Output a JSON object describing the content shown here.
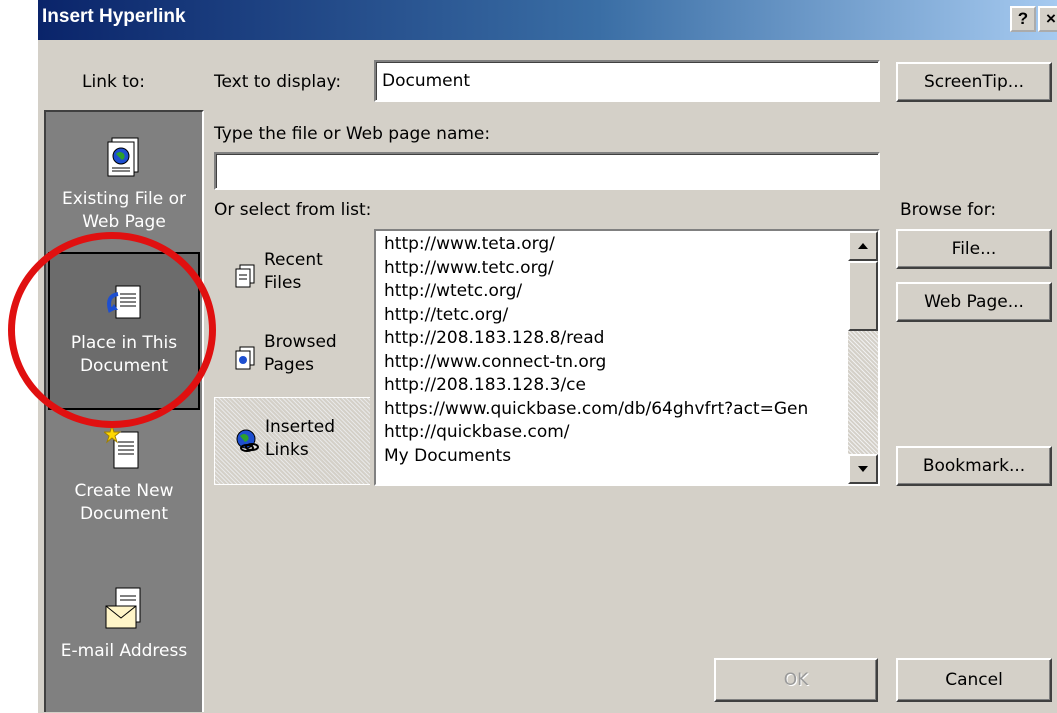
{
  "window": {
    "title": "Insert Hyperlink",
    "help_label": "?",
    "close_label": "×"
  },
  "linkto": {
    "label": "Link to:",
    "places": [
      {
        "line1": "Existing File or",
        "line2": "Web Page",
        "icon": "existing-file-icon"
      },
      {
        "line1": "Place in This",
        "line2": "Document",
        "icon": "place-in-document-icon"
      },
      {
        "line1": "Create New",
        "line2": "Document",
        "icon": "create-document-icon"
      },
      {
        "line1": "E-mail Address",
        "line2": "",
        "icon": "email-icon"
      }
    ]
  },
  "text_to_display": {
    "label": "Text to display:",
    "value": "Document"
  },
  "screentip_label": "ScreenTip...",
  "filename": {
    "label": "Type the file or Web page name:",
    "value": ""
  },
  "list_label": "Or select from list:",
  "browse_label": "Browse for:",
  "tabs": [
    {
      "line1": "Recent",
      "line2": "Files",
      "icon": "recent-files-icon"
    },
    {
      "line1": "Browsed",
      "line2": "Pages",
      "icon": "browsed-pages-icon"
    },
    {
      "line1": "Inserted",
      "line2": "Links",
      "icon": "inserted-links-icon"
    }
  ],
  "links": [
    "http://www.teta.org/",
    "http://www.tetc.org/",
    "http://wtetc.org/",
    "http://tetc.org/",
    "http://208.183.128.8/read",
    "http://www.connect-tn.org",
    "http://208.183.128.3/ce",
    "https://www.quickbase.com/db/64ghvfrt?act=Gen",
    "http://quickbase.com/",
    "My Documents"
  ],
  "buttons": {
    "file": "File...",
    "web_page": "Web Page...",
    "bookmark": "Bookmark...",
    "ok": "OK",
    "cancel": "Cancel"
  },
  "colors": {
    "highlight_circle": "#e01010",
    "title_bar": "#0a246a"
  }
}
